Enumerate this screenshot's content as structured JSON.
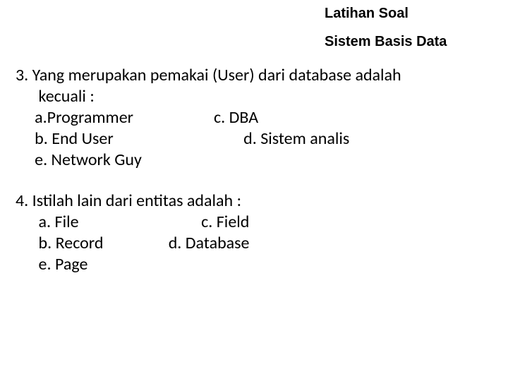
{
  "header": {
    "title": "Latihan Soal",
    "subtitle": "Sistem Basis Data"
  },
  "q3": {
    "line1": "3. Yang merupakan pemakai (User) dari database adalah",
    "line2": "      kecuali :",
    "line3": "     a.Programmer                     c. DBA",
    "line4": "     b. End User                                  d. Sistem analis",
    "line5": "     e. Network Guy"
  },
  "q4": {
    "line1": "4. Istilah lain dari entitas adalah :",
    "line2": "      a. File                                c. Field",
    "line3": "      b. Record                 d. Database",
    "line4": "      e. Page"
  }
}
